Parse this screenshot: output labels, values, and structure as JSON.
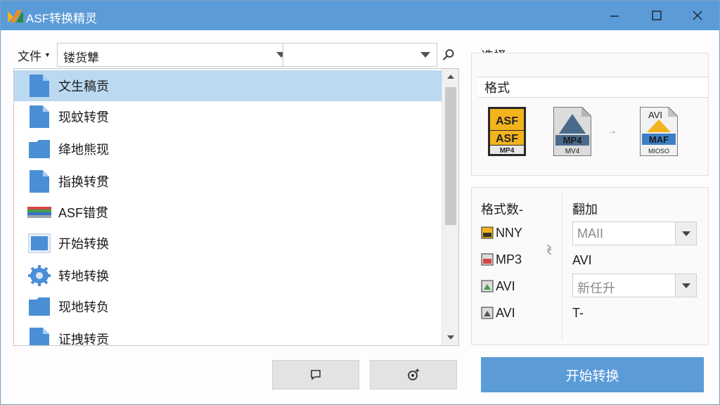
{
  "window": {
    "title": "ASF转换精灵",
    "minimize_icon": "minimize-icon",
    "maximize_icon": "maximize-icon",
    "close_icon": "close-icon"
  },
  "toolbar": {
    "file_menu_label": "文件",
    "path_value": "镂货犨",
    "filter_value": "",
    "search_icon": "search-icon"
  },
  "file_list": {
    "items": [
      {
        "label": "文生稿贡",
        "icon": "file-icon",
        "selected": true
      },
      {
        "label": "现蚊转贯",
        "icon": "file-icon",
        "selected": false
      },
      {
        "label": "绛地熊现",
        "icon": "folder-icon",
        "selected": false
      },
      {
        "label": "指换转贯",
        "icon": "file-icon",
        "selected": false
      },
      {
        "label": "ASF错贯",
        "icon": "color-bars-icon",
        "selected": false
      },
      {
        "label": "开始转换",
        "icon": "monitor-icon",
        "selected": false
      },
      {
        "label": "转地转换",
        "icon": "gear-icon",
        "selected": false
      },
      {
        "label": "现地转负",
        "icon": "folder-icon",
        "selected": false
      },
      {
        "label": "证拽转贡",
        "icon": "file-icon",
        "selected": false
      }
    ]
  },
  "bottom_buttons": {
    "left_icon": "comment-icon",
    "right_icon": "settings-icon",
    "start_label": "开始转换"
  },
  "right_panel": {
    "select_title": "选择",
    "format_header": "格式",
    "format_icons": [
      {
        "top": "ASF",
        "bottom": "ASF",
        "sub": "MP4"
      },
      {
        "top": "",
        "bottom": "MP4",
        "sub": "MV4"
      },
      {
        "top": "AVI",
        "bottom": "MAF",
        "sub": "MIOSO"
      }
    ],
    "arrow_text": "→",
    "options_label": "格式数-",
    "formats": [
      "NNY",
      "MP3",
      "AVI",
      "AVI"
    ],
    "swap_icon": "swap-icon",
    "add_label": "翻加",
    "select1_value": "MAII",
    "avi_label": "AVI",
    "select2_value": "新任升",
    "t_label": "T-"
  },
  "colors": {
    "accent": "#5b9bd8",
    "selected_row": "#bcd9f2"
  }
}
